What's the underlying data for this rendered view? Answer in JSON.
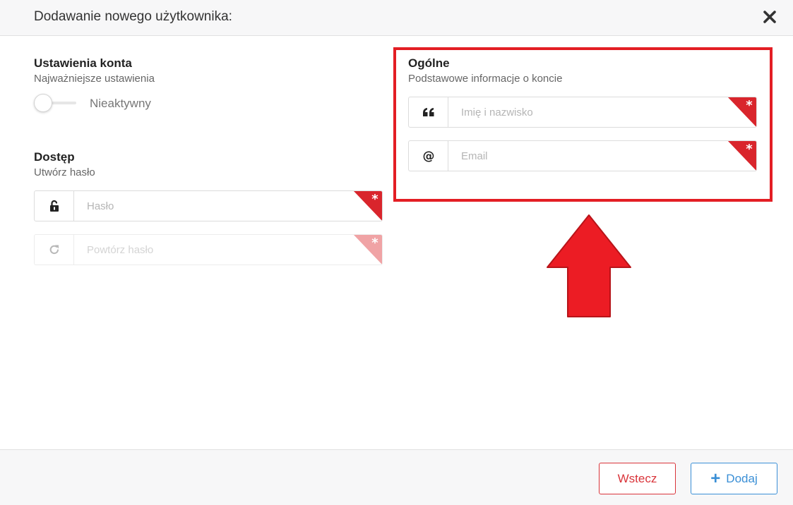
{
  "dialog": {
    "title": "Dodawanie nowego użytkownika:",
    "close_icon": "close-icon"
  },
  "account_settings": {
    "title": "Ustawienia konta",
    "subtitle": "Najważniejsze ustawienia",
    "toggle_label": "Nieaktywny",
    "toggle_on": false
  },
  "access": {
    "title": "Dostęp",
    "subtitle": "Utwórz hasło",
    "password": {
      "icon": "unlock-icon",
      "placeholder": "Hasło",
      "value": "",
      "required": true
    },
    "repeat_password": {
      "icon": "refresh-icon",
      "placeholder": "Powtórz hasło",
      "value": "",
      "required": true,
      "disabled": true
    }
  },
  "general": {
    "title": "Ogólne",
    "subtitle": "Podstawowe informacje o koncie",
    "full_name": {
      "icon": "quote-icon",
      "placeholder": "Imię i nazwisko",
      "value": "",
      "required": true
    },
    "email": {
      "icon": "at-icon",
      "placeholder": "Email",
      "value": "",
      "required": true
    }
  },
  "footer": {
    "back_label": "Wstecz",
    "add_label": "Dodaj"
  },
  "colors": {
    "required_marker": "#d9252c",
    "required_marker_disabled": "#f0a3a5",
    "highlight": "#e31e24",
    "primary": "#3a8fd6",
    "danger": "#d9343a"
  }
}
